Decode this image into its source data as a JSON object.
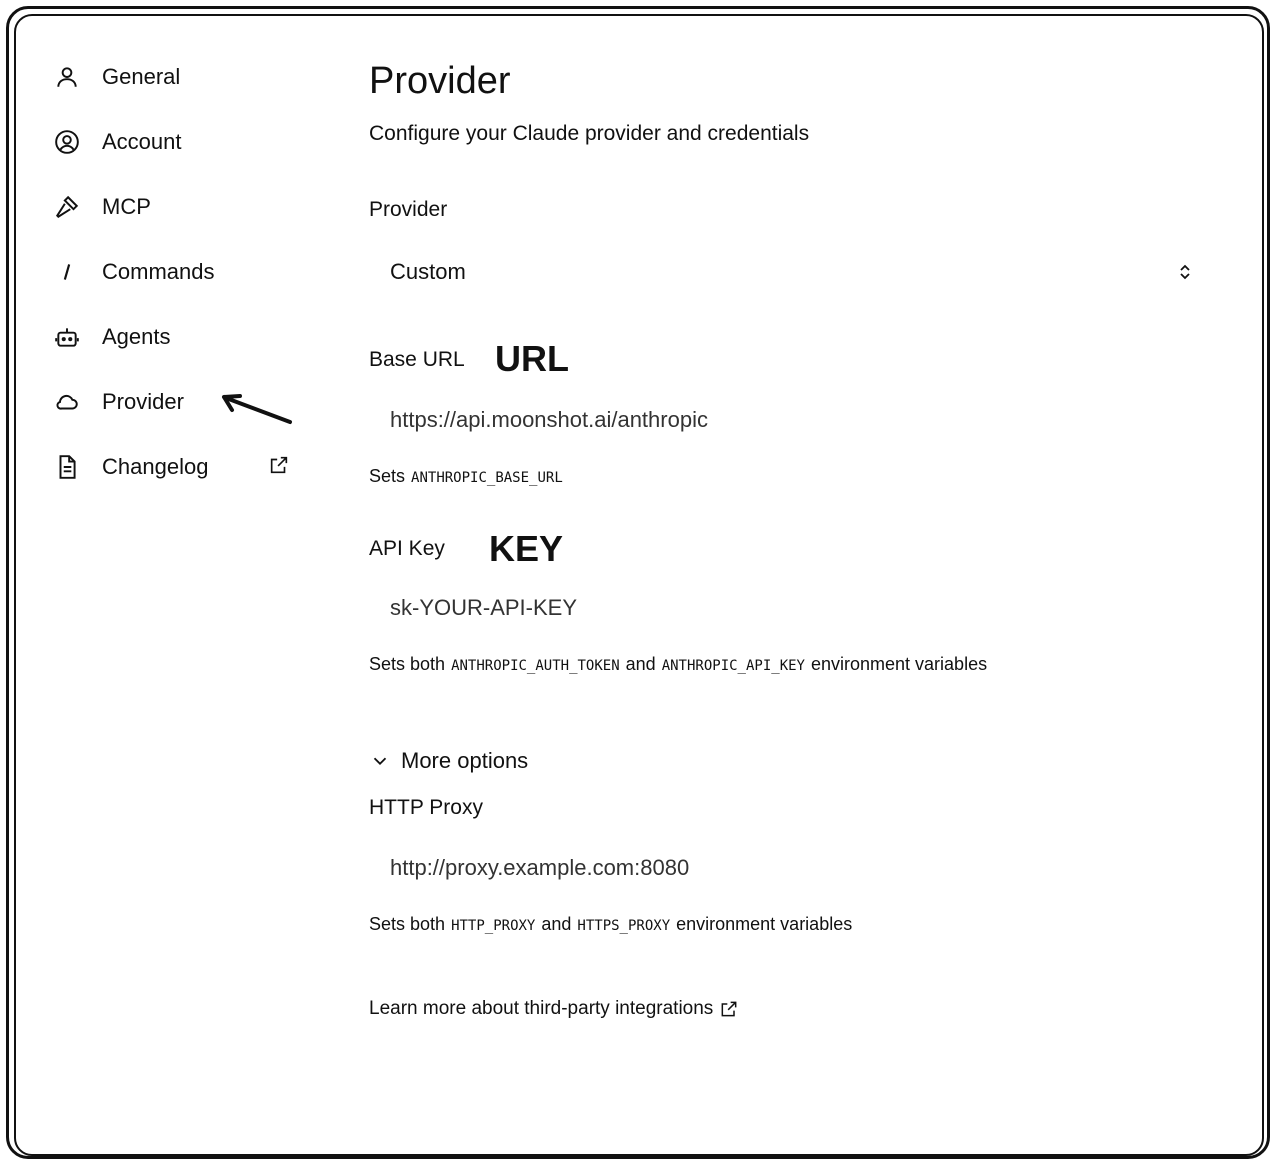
{
  "sidebar": {
    "items": [
      {
        "label": "General",
        "icon": "user-icon"
      },
      {
        "label": "Account",
        "icon": "user-circle-icon"
      },
      {
        "label": "MCP",
        "icon": "hammer-icon"
      },
      {
        "label": "Commands",
        "icon": "slash-icon"
      },
      {
        "label": "Agents",
        "icon": "robot-icon"
      },
      {
        "label": "Provider",
        "icon": "cloud-icon",
        "active": true
      },
      {
        "label": "Changelog",
        "icon": "document-icon",
        "external": true
      }
    ]
  },
  "main": {
    "title": "Provider",
    "subtitle": "Configure your Claude provider and credentials",
    "provider": {
      "label": "Provider",
      "selected": "Custom"
    },
    "base_url": {
      "label": "Base URL",
      "annotation": "URL",
      "value": "https://api.moonshot.ai/anthropic",
      "help_prefix": "Sets",
      "help_code": "ANTHROPIC_BASE_URL"
    },
    "api_key": {
      "label": "API Key",
      "annotation": "KEY",
      "value": "sk-YOUR-API-KEY",
      "help_prefix": "Sets both",
      "help_code1": "ANTHROPIC_AUTH_TOKEN",
      "help_and": "and",
      "help_code2": "ANTHROPIC_API_KEY",
      "help_suffix": "environment variables"
    },
    "more_options": "More options",
    "http_proxy": {
      "label": "HTTP Proxy",
      "placeholder": "http://proxy.example.com:8080",
      "help_prefix": "Sets both",
      "help_code1": "HTTP_PROXY",
      "help_and": "and",
      "help_code2": "HTTPS_PROXY",
      "help_suffix": "environment variables"
    },
    "learn_more": "Learn more about third-party integrations"
  }
}
